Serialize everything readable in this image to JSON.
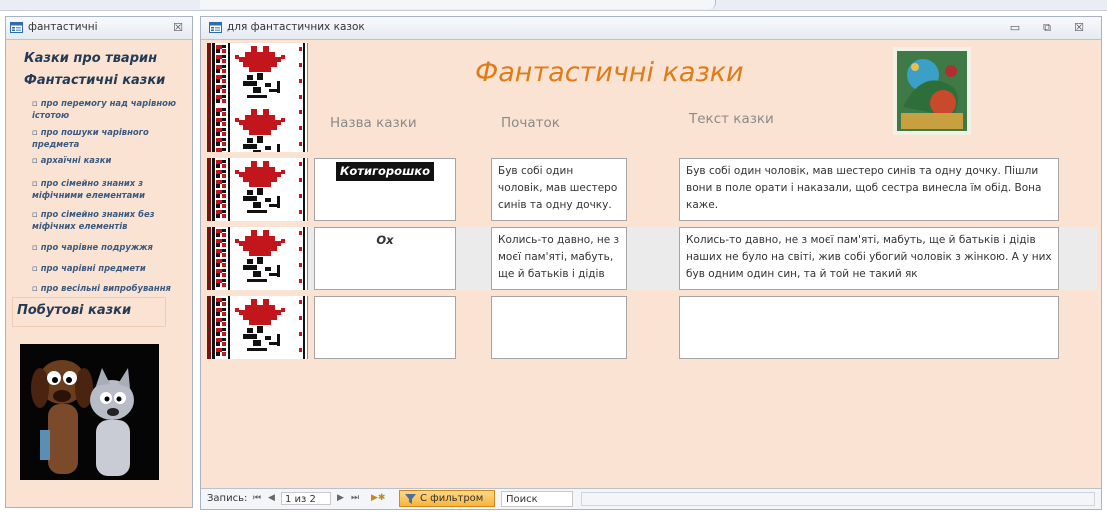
{
  "left_window": {
    "title": "фантастичні",
    "close_glyph": "☒",
    "nav_items": [
      {
        "label": "Казки про тварин",
        "level": "heading"
      },
      {
        "label": "Фантастичні казки",
        "level": "heading"
      },
      {
        "label": "про перемогу над чарівною істотою",
        "level": "sub"
      },
      {
        "label": "про пошуки чарівного предмета",
        "level": "sub"
      },
      {
        "label": "архаїчні казки",
        "level": "sub"
      },
      {
        "label": "про сімейно знаних з міфічними елементами",
        "level": "sub"
      },
      {
        "label": "про сімейно знаних без міфічних елементів",
        "level": "sub"
      },
      {
        "label": "про чарівне подружжя",
        "level": "sub"
      },
      {
        "label": "про чарівні предмети",
        "level": "sub"
      },
      {
        "label": "про весільні випробування",
        "level": "sub"
      }
    ],
    "pobutovi": "Побутові казки",
    "bullet": "▫"
  },
  "main_window": {
    "title": "для фантастичних казок",
    "form_title": "Фантастичні казки",
    "columns": {
      "name": "Назва казки",
      "start": "Початок",
      "text": "Текст казки"
    },
    "rows": [
      {
        "name": "Котигорошко",
        "start": "Був собі один чоловік, мав шестеро синів та одну дочку.",
        "text": "Був собі один чоловік, мав шестеро синів та одну дочку. Пішли вони в поле орати і наказали, щоб сестра винесла їм обід. Вона каже."
      },
      {
        "name": "Ох",
        "start": "Колись-то давно, не з моєї пам'яті, мабуть, ще й батьків і дідів",
        "text": "Колись-то давно, не з моєї пам'яті, мабуть, ще й батьків і дідів наших не було на світі, жив собі убогий чоловік з жінкою. А у них був одним один син, та й той не такий як"
      },
      {
        "name": "",
        "start": "",
        "text": ""
      }
    ],
    "window_buttons": {
      "minimize": "▭",
      "restore": "⧉",
      "close": "☒"
    }
  },
  "status_bar": {
    "record_label": "Запись:",
    "record_value": "1 из 2",
    "filter_label": "С фильтром",
    "search_placeholder": "Поиск",
    "first": "⏮",
    "prev": "◀",
    "next": "▶",
    "last": "⏭",
    "new": "▶✱"
  },
  "colors": {
    "form_background": "#fbe3d3",
    "title_orange": "#e07b17",
    "nav_text": "#243b55",
    "filter_button": "#f7b53a"
  }
}
